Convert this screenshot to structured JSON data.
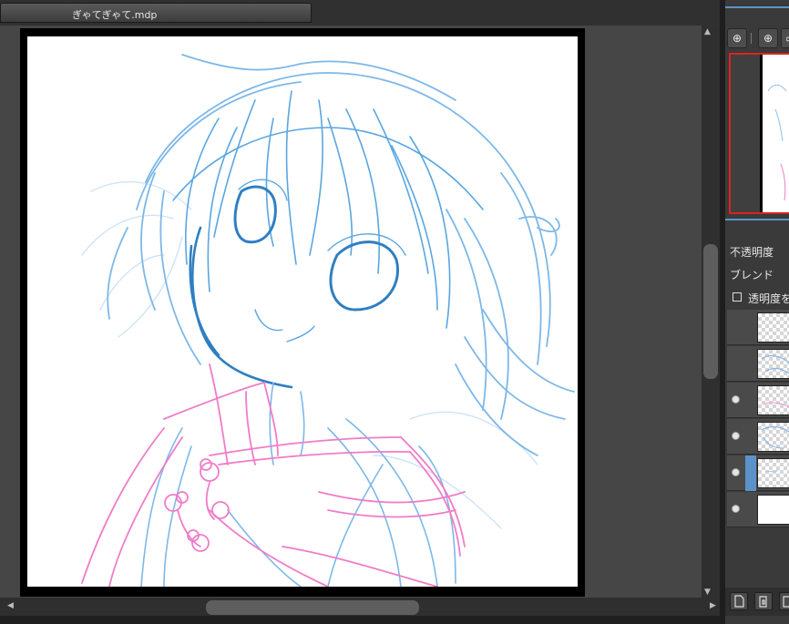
{
  "document": {
    "tab_title": "ぎゃてぎゃて.mdp"
  },
  "scrollbars": {
    "up": "▲",
    "down": "▼",
    "left": "◀",
    "right": "▶"
  },
  "navigator": {
    "buttons": [
      {
        "icon": "zoom-fit-icon",
        "glyph": "⊕"
      },
      {
        "icon": "zoom-in-icon",
        "glyph": "⊕"
      },
      {
        "icon": "zoom-out-icon",
        "glyph": "▭"
      }
    ]
  },
  "layer_properties": {
    "opacity_label": "不透明度",
    "blend_label": "ブレンド",
    "protect_alpha_label": "透明度を"
  },
  "layers": [
    {
      "visible": false,
      "selected": false,
      "kind": "empty"
    },
    {
      "visible": false,
      "selected": false,
      "kind": "blue-sketch"
    },
    {
      "visible": true,
      "selected": false,
      "kind": "pink-sketch"
    },
    {
      "visible": true,
      "selected": false,
      "kind": "blue-sketch"
    },
    {
      "visible": true,
      "selected": true,
      "kind": "light-sketch"
    },
    {
      "visible": true,
      "selected": false,
      "kind": "paper"
    }
  ],
  "colors": {
    "sketch_blue": "#5aa6e0",
    "sketch_blue_dark": "#2f7fc2",
    "sketch_pink": "#f07cc8",
    "selection": "#5b93c9",
    "navigator_frame": "#dd2222"
  }
}
